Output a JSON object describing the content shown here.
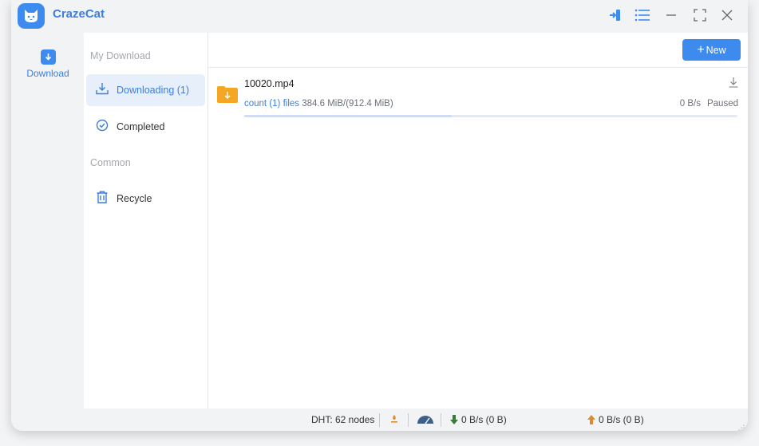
{
  "app": {
    "title": "CrazeCat"
  },
  "rail": {
    "download_label": "Download"
  },
  "sidebar": {
    "section_my_download": "My Download",
    "items": [
      {
        "label": "Downloading (1)",
        "active": true
      },
      {
        "label": "Completed",
        "active": false
      }
    ],
    "section_common": "Common",
    "recycle_label": "Recycle"
  },
  "toolbar": {
    "new_label": "New"
  },
  "tasks": [
    {
      "name": "10020.mp4",
      "count_text": "count (1) files",
      "size_text": "384.6 MiB/(912.4 MiB)",
      "speed": "0 B/s",
      "status": "Paused",
      "progress_percent": 42
    }
  ],
  "statusbar": {
    "dht": "DHT: 62 nodes",
    "download": "0 B/s (0 B)",
    "upload": "0 B/s (0 B)"
  },
  "colors": {
    "accent": "#3d8bef",
    "folder": "#f5a623",
    "download_arrow": "#3a7a3a",
    "upload_arrow": "#e08a2e"
  }
}
